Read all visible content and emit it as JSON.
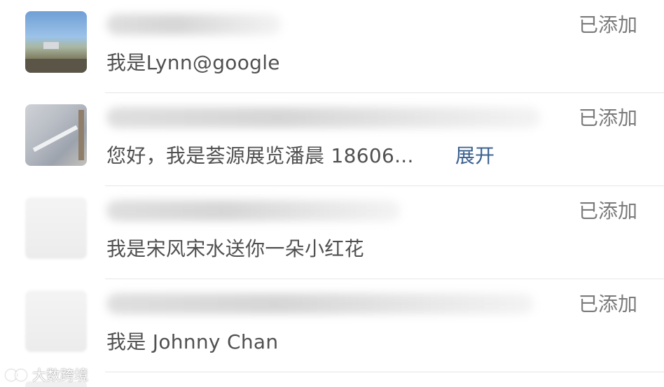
{
  "requests": [
    {
      "message": "我是Lynn@google",
      "status": "已添加",
      "expand": "",
      "avatar": "avatar-landscape-photo"
    },
    {
      "message": "您好，我是荟源展览潘晨 18606...",
      "status": "已添加",
      "expand": "展开",
      "avatar": "avatar-photo"
    },
    {
      "message": "我是宋风宋水送你一朵小红花",
      "status": "已添加",
      "expand": "",
      "avatar": "avatar-photo"
    },
    {
      "message": "我是 Johnny Chan",
      "status": "已添加",
      "expand": "",
      "avatar": "avatar-photo"
    }
  ],
  "watermark": {
    "text": "大数跨境",
    "logo": "brand-logo"
  },
  "colors": {
    "status": "#7a7a7a",
    "message": "#505050",
    "link": "#3a5f8e",
    "divider": "#e6e6e6"
  }
}
